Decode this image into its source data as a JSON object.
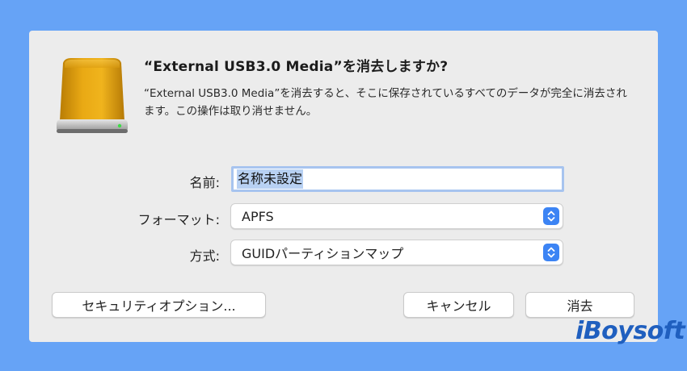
{
  "dialog": {
    "title": "“External USB3.0 Media”を消去しますか?",
    "message": "“External USB3.0 Media”を消去すると、そこに保存されているすべてのデータが完全に消去されます。この操作は取り消せません。",
    "icon": "external-drive-icon",
    "accent_color": "#3c84f4"
  },
  "form": {
    "name_label": "名前:",
    "name_value": "名称未設定",
    "format_label": "フォーマット:",
    "format_value": "APFS",
    "scheme_label": "方式:",
    "scheme_value": "GUIDパーティションマップ"
  },
  "buttons": {
    "security_options": "セキュリティオプション...",
    "cancel": "キャンセル",
    "erase": "消去"
  },
  "watermark": "iBoysoft"
}
